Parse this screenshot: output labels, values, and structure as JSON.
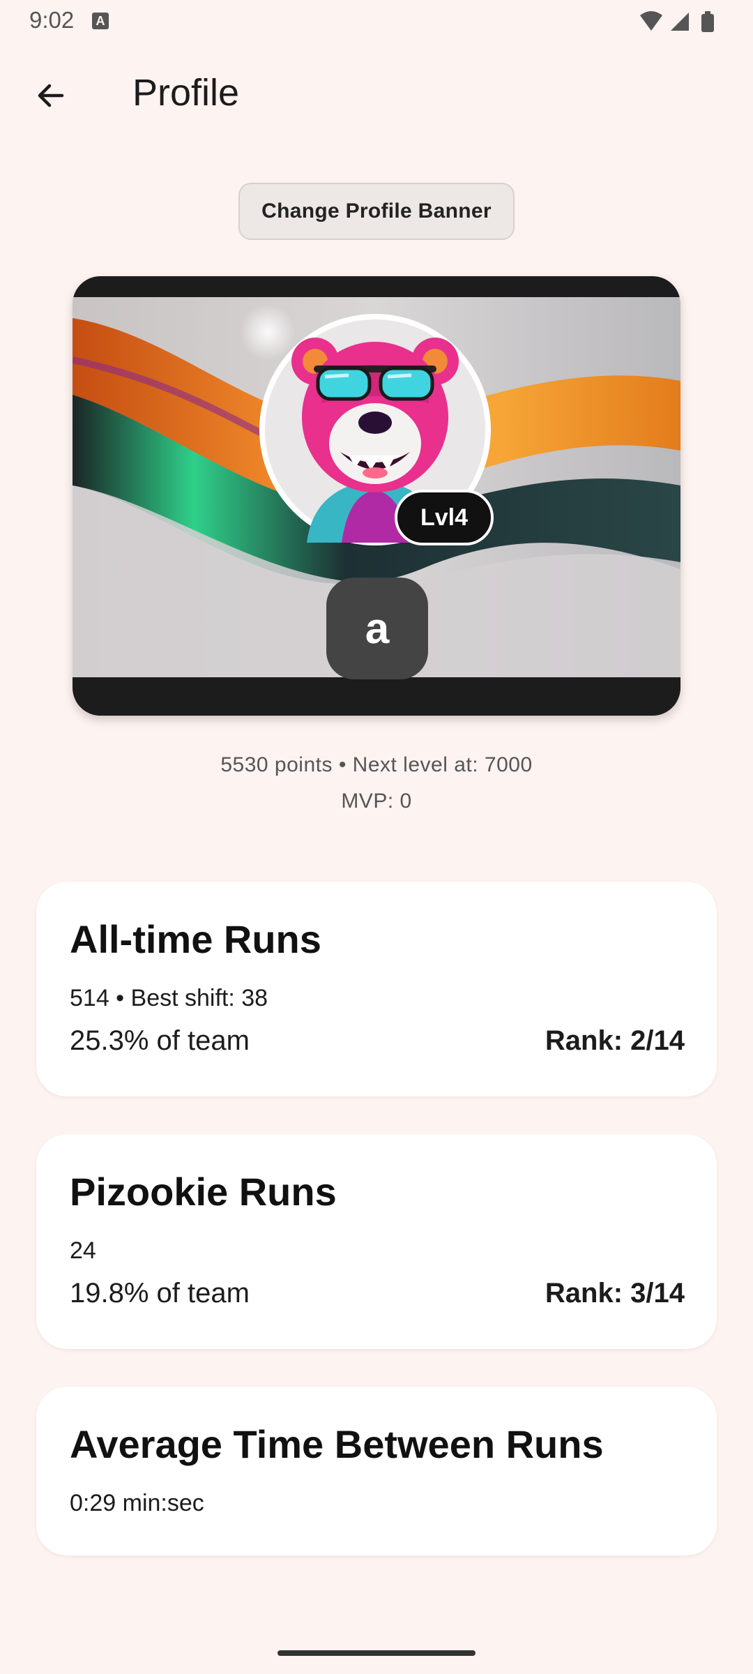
{
  "status_bar": {
    "time": "9:02",
    "notification_icon": "a-badge-icon",
    "icons": [
      "wifi-icon",
      "cell-signal-icon",
      "battery-icon"
    ]
  },
  "header": {
    "title": "Profile",
    "back_icon": "arrow-left-icon"
  },
  "banner": {
    "change_banner_label": "Change Profile Banner",
    "level_label": "Lvl4",
    "initial": "a"
  },
  "summary": {
    "points_line": "5530 points • Next level at: 7000",
    "mvp_line": "MVP: 0"
  },
  "cards": [
    {
      "title": "All-time Runs",
      "subtitle": "514 • Best shift: 38",
      "percent": "25.3% of team",
      "rank": "Rank: 2/14"
    },
    {
      "title": "Pizookie Runs",
      "subtitle": "24",
      "percent": "19.8% of team",
      "rank": "Rank: 3/14"
    },
    {
      "title": "Average Time Between Runs",
      "subtitle": "0:29 min:sec"
    }
  ],
  "colors": {
    "background": "#fdf3f1",
    "card": "#ffffff",
    "badge": "#111111",
    "initial_button": "#444444",
    "bear_fur": "#e8308c",
    "sunglasses": "#3fd4e0"
  }
}
